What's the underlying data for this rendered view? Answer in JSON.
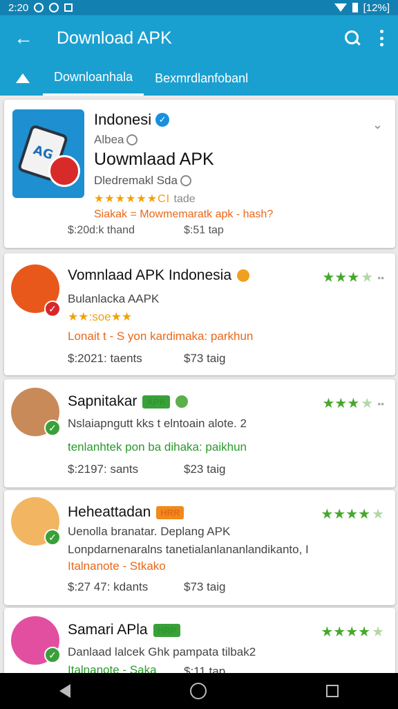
{
  "status_bar": {
    "time": "2:20",
    "battery": "[12%]"
  },
  "app_bar": {
    "title": "Download APK",
    "back_icon": "arrow-left-icon",
    "search_icon": "search-icon",
    "more_icon": "more-vertical-icon"
  },
  "tabs": {
    "home_icon": "home-icon",
    "items": [
      {
        "label": "Downloanhala"
      },
      {
        "label": "Bexmrdlanfobanl"
      }
    ]
  },
  "featured": {
    "name": "Indonesi",
    "dev": "Albea",
    "title": "Uowmlaad APK",
    "subtitle": "Dledremakl Sda",
    "stars": "★★★★★★CI",
    "stars_extra": "tade",
    "tagline": "Siakak = Mowmemaratk apk - hash?",
    "price": "$:20d:k thand",
    "size": "$:51 tap"
  },
  "apps": [
    {
      "name": "Vomnlaad APK Indonesia",
      "line1": "Bulanlacka AAPK",
      "line2": "★★:soe★★",
      "line3": "Lonait t - S yon kardimaka: parkhun",
      "price": "$:2021: taents",
      "size": "$73 taig",
      "rating": 3.5
    },
    {
      "name": "Sapnitakar",
      "chip": "APK",
      "line1": "Nslaiapngutt kks t elntoain alote. 2",
      "line2": "tenlanhtek pon ba dihaka: paikhun",
      "price": "$:2197: sants",
      "size": "$23 taig",
      "rating": 3.5
    },
    {
      "name": "Heheattadan",
      "chip": "HRR",
      "line1": "Uenolla branatar. Deplang APK",
      "line2": "Lonpdarnenaralns tanetialanlananlandikanto, I",
      "line3": "Italnanote - Stkako",
      "price": "$:27 47: kdants",
      "size": "$73 taig",
      "rating": 4.5
    },
    {
      "name": "Samari APla",
      "chip": "HRP",
      "line1": "Danlaad lalcek Ghk pampata tilbak2",
      "line2": "Italnanote - Saka",
      "price": "$:11 tap",
      "rating": 4.5
    }
  ],
  "colors": {
    "app_bar": "#1aa0d0",
    "status_bar": "#1281b1",
    "star_green": "#46a82a",
    "accent_orange": "#e8681a"
  },
  "nav_bar": {
    "back_icon": "nav-back-icon",
    "home_icon": "nav-home-icon",
    "recents_icon": "nav-recents-icon"
  }
}
